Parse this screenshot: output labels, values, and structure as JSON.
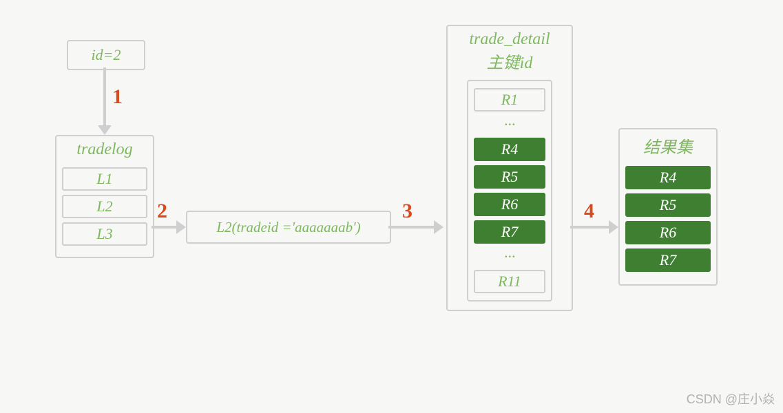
{
  "input": {
    "label": "id=2"
  },
  "steps": {
    "s1": "1",
    "s2": "2",
    "s3": "3",
    "s4": "4"
  },
  "tradelog": {
    "title": "tradelog",
    "rows": [
      "L1",
      "L2",
      "L3"
    ]
  },
  "lookup": {
    "text": "L2(tradeid ='aaaaaaab')"
  },
  "trade_detail": {
    "title_line1": "trade_detail",
    "title_line2": "主键id",
    "rows": [
      {
        "text": "R1",
        "highlight": false
      },
      {
        "text": "···",
        "highlight": false,
        "noborder": true
      },
      {
        "text": "R4",
        "highlight": true
      },
      {
        "text": "R5",
        "highlight": true
      },
      {
        "text": "R6",
        "highlight": true
      },
      {
        "text": "R7",
        "highlight": true
      },
      {
        "text": "···",
        "highlight": false,
        "noborder": true
      },
      {
        "text": "R11",
        "highlight": false
      }
    ]
  },
  "result": {
    "title": "结果集",
    "rows": [
      "R4",
      "R5",
      "R6",
      "R7"
    ]
  },
  "watermark": "CSDN @庄小焱"
}
